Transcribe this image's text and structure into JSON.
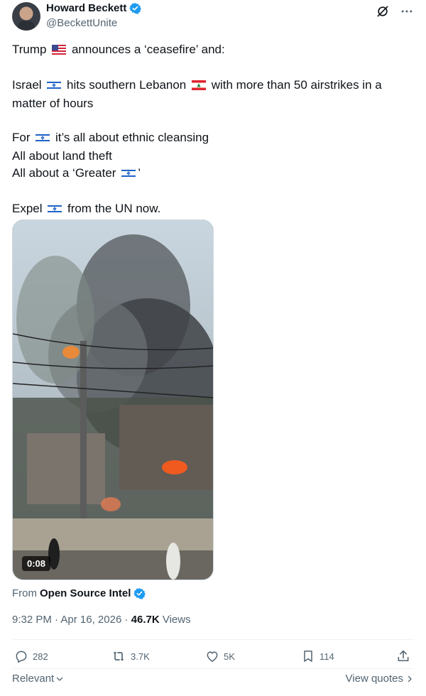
{
  "author": {
    "name": "Howard Beckett",
    "handle": "@BeckettUnite"
  },
  "post": {
    "lines": [
      {
        "parts": [
          "Trump ",
          "{flag:us}",
          " announces a ‘ceasefire’ and:"
        ]
      },
      {
        "parts": [
          ""
        ]
      },
      {
        "parts": [
          "Israel ",
          "{flag:il}",
          " hits southern Lebanon ",
          "{flag:lb}",
          " with more than 50 airstrikes in a"
        ]
      },
      {
        "parts": [
          "matter of hours"
        ]
      },
      {
        "parts": [
          ""
        ]
      },
      {
        "parts": [
          "For ",
          "{flag:il}",
          " it’s all about ethnic cleansing"
        ]
      },
      {
        "parts": [
          "All about land theft"
        ]
      },
      {
        "parts": [
          "All about a ‘Greater ",
          "{flag:il}",
          "’"
        ]
      },
      {
        "parts": [
          ""
        ]
      },
      {
        "parts": [
          "Expel ",
          "{flag:il}",
          " from the UN now."
        ]
      }
    ]
  },
  "media": {
    "duration": "0:08"
  },
  "source": {
    "prefix": "From",
    "name": "Open Source Intel"
  },
  "meta": {
    "time": "9:32 PM",
    "date": "Apr 16, 2026",
    "views_count": "46.7K",
    "views_label": "Views"
  },
  "actions": {
    "replies": "282",
    "reposts": "3.7K",
    "likes": "5K",
    "bookmarks": "114"
  },
  "footer": {
    "relevant": "Relevant",
    "view_quotes": "View quotes"
  },
  "colors": {
    "accent": "#1d9bf0",
    "text": "#0f1419",
    "secondary": "#536471"
  }
}
